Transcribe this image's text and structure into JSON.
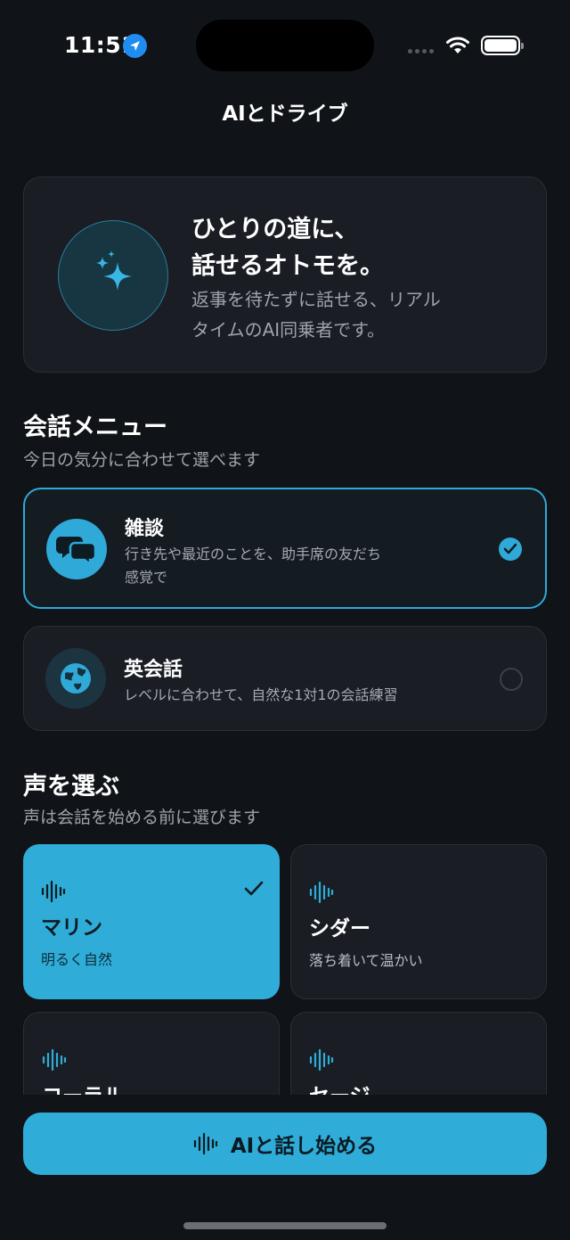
{
  "status_bar": {
    "time": "11:51"
  },
  "nav": {
    "title": "AIとドライブ"
  },
  "hero": {
    "title_line1": "ひとりの道に、",
    "title_line2": "話せるオトモを。",
    "desc_line1": "返事を待たずに話せる、リアル",
    "desc_line2": "タイムのAI同乗者です。"
  },
  "menu_section": {
    "title": "会話メニュー",
    "subtitle": "今日の気分に合わせて選べます",
    "items": [
      {
        "title": "雑談",
        "desc_line1": "行き先や最近のことを、助手席の友だち",
        "desc_line2": "感覚で",
        "selected": true,
        "icon": "chat-bubbles-icon"
      },
      {
        "title": "英会話",
        "desc_line1": "レベルに合わせて、自然な1対1の会話練習",
        "desc_line2": "",
        "selected": false,
        "icon": "globe-icon"
      }
    ]
  },
  "voice_section": {
    "title": "声を選ぶ",
    "subtitle": "声は会話を始める前に選びます",
    "voices": [
      {
        "name": "マリン",
        "desc": "明るく自然",
        "selected": true
      },
      {
        "name": "シダー",
        "desc": "落ち着いて温かい",
        "selected": false
      },
      {
        "name": "コーラル",
        "desc": "",
        "selected": false
      },
      {
        "name": "セージ",
        "desc": "",
        "selected": false
      }
    ]
  },
  "start_button": {
    "label": "AIと話し始める"
  },
  "colors": {
    "accent": "#2fadd8",
    "background": "#101317",
    "card": "#1a1d23"
  }
}
